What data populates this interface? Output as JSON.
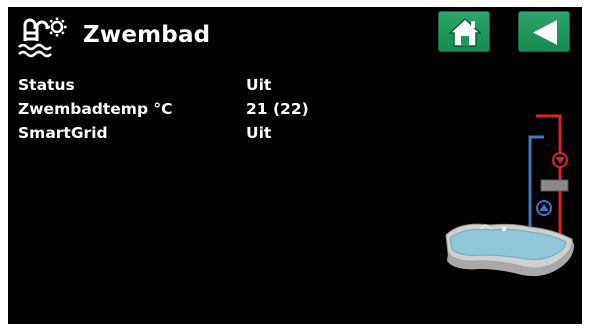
{
  "header": {
    "title": "Zwembad",
    "icon": "pool-icon"
  },
  "nav": {
    "home_icon": "home-icon",
    "back_icon": "back-arrow-icon"
  },
  "status": {
    "rows": [
      {
        "label": "Status",
        "value": "Uit"
      },
      {
        "label": "Zwembadtemp °C",
        "value": "21 (22)"
      },
      {
        "label": "SmartGrid",
        "value": "Uit"
      }
    ]
  },
  "diagram": {
    "flow_icon": "flow-down-icon",
    "return_icon": "flow-up-icon",
    "pool_illustration": "pool-illustration"
  },
  "colors": {
    "background": "#000000",
    "text": "#ffffff",
    "button": "#1f9a5c",
    "hot_pipe": "#e2202a",
    "cold_pipe": "#3a78c4"
  }
}
